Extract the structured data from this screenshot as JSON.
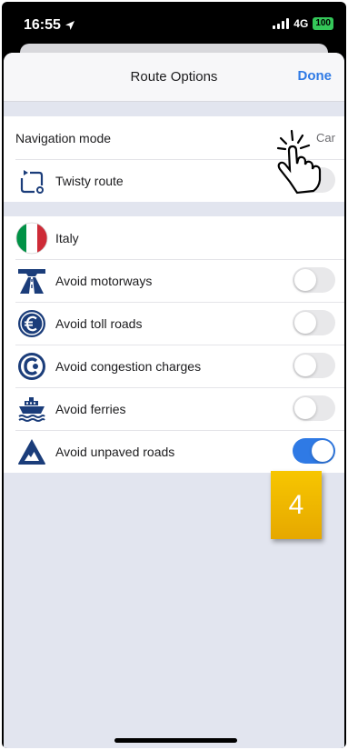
{
  "status_bar": {
    "time": "16:55",
    "network": "4G",
    "battery": "100"
  },
  "header": {
    "title": "Route Options",
    "done_label": "Done"
  },
  "navigation_section": {
    "mode_label": "Navigation mode",
    "mode_value": "Car",
    "twisty_label": "Twisty route",
    "twisty_on": false
  },
  "country": {
    "name": "Italy",
    "flag_colors": [
      "#009246",
      "#ffffff",
      "#ce2b37"
    ]
  },
  "avoid_options": [
    {
      "label": "Avoid motorways",
      "icon": "motorway-icon",
      "on": false
    },
    {
      "label": "Avoid toll roads",
      "icon": "euro-icon",
      "on": false
    },
    {
      "label": "Avoid congestion charges",
      "icon": "congestion-charge-icon",
      "on": false
    },
    {
      "label": "Avoid ferries",
      "icon": "ferry-icon",
      "on": false
    },
    {
      "label": "Avoid unpaved roads",
      "icon": "unpaved-road-icon",
      "on": true
    }
  ],
  "step_badge": "4",
  "colors": {
    "accent": "#2f7ae5",
    "icon_navy": "#1b3d7a",
    "badge": "#f2b800",
    "toggle_off": "#e8e8ea"
  }
}
